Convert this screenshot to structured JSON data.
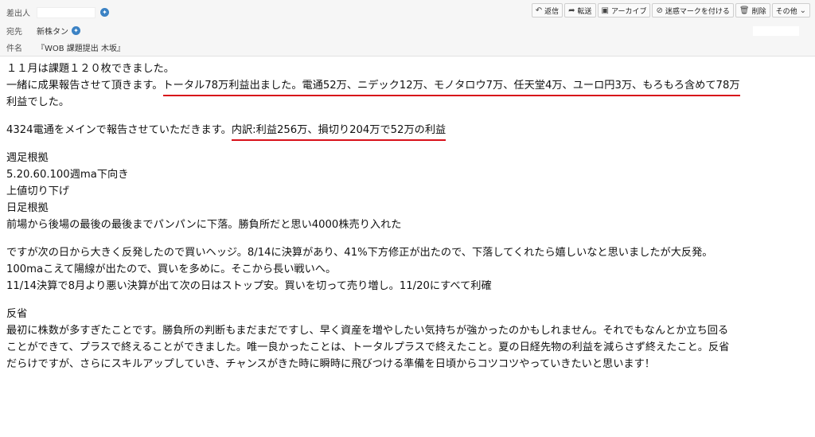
{
  "header": {
    "from_label": "差出人",
    "to_label": "宛先",
    "to_value": "新株タン",
    "subject_label": "件名",
    "subject_value": "『WOB 課題提出 木坂』"
  },
  "toolbar": {
    "reply": "返信",
    "forward": "転送",
    "archive": "アーカイブ",
    "junk": "迷惑マークを付ける",
    "delete": "削除",
    "other": "その他"
  },
  "body": {
    "l1": "１１月は課題１２０枚できました。",
    "l2a": "一緒に成果報告させて頂きます。",
    "l2b": "トータル78万利益出ました。電通52万、ニデック12万、モノタロウ7万、任天堂4万、ユーロ円3万、もろもろ含めて78万",
    "l3": "利益でした。",
    "l4a": "4324電通をメインで報告させていただきます。",
    "l4b": "内訳:利益256万、損切り204万で52万の利益",
    "l5": "週足根拠",
    "l6": "5.20.60.100週ma下向き",
    "l7": "上値切り下げ",
    "l8": "日足根拠",
    "l9": "前場から後場の最後の最後までパンパンに下落。勝負所だと思い4000株売り入れた",
    "l10": "ですが次の日から大きく反発したので買いヘッジ。8/14に決算があり、41%下方修正が出たので、下落してくれたら嬉しいなと思いましたが大反発。",
    "l11": "100maこえて陽線が出たので、買いを多めに。そこから長い戦いへ。",
    "l12": "11/14決算で8月より悪い決算が出て次の日はストップ安。買いを切って売り増し。11/20にすべて利確",
    "l13": "反省",
    "l14": "最初に株数が多すぎたことです。勝負所の判断もまだまだですし、早く資産を増やしたい気持ちが強かったのかもしれません。それでもなんとか立ち回る",
    "l15": "ことができて、プラスで終えることができました。唯一良かったことは、トータルプラスで終えたこと。夏の日経先物の利益を減らさず終えたこと。反省",
    "l16": "だらけですが、さらにスキルアップしていき、チャンスがきた時に瞬時に飛びつける準備を日頃からコツコツやっていきたいと思います！"
  },
  "colors": {
    "underline": "#d8101a",
    "icon": "#3b82c4"
  },
  "icons": [
    "contact-icon",
    "reply-icon",
    "forward-icon",
    "archive-icon",
    "junk-icon",
    "trash-icon",
    "chevron-down-icon"
  ]
}
